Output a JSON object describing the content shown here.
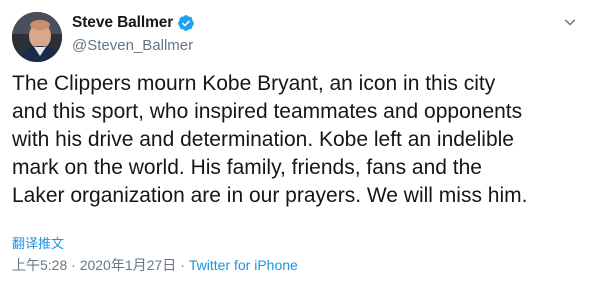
{
  "author": {
    "display_name": "Steve Ballmer",
    "handle": "@Steven_Ballmer",
    "verified": true,
    "avatar_icon": "profile-photo"
  },
  "menu": {
    "icon": "chevron-down-icon"
  },
  "tweet": {
    "lines": [
      "The Clippers mourn Kobe Bryant, an icon in this city",
      "and this sport, who inspired teammates and opponents",
      "with his drive and determination. Kobe left an indelible",
      "mark on the world. His family, friends, fans and the",
      "Laker organization are in our prayers. We will miss him."
    ]
  },
  "translate": {
    "label": "翻译推文"
  },
  "meta": {
    "timestamp": "上午5:28 · 2020年1月27日",
    "separator": "·",
    "source": "Twitter for iPhone"
  },
  "colors": {
    "text": "#14171a",
    "secondary": "#657786",
    "link": "#1b95e0",
    "verified": "#1da1f2"
  }
}
